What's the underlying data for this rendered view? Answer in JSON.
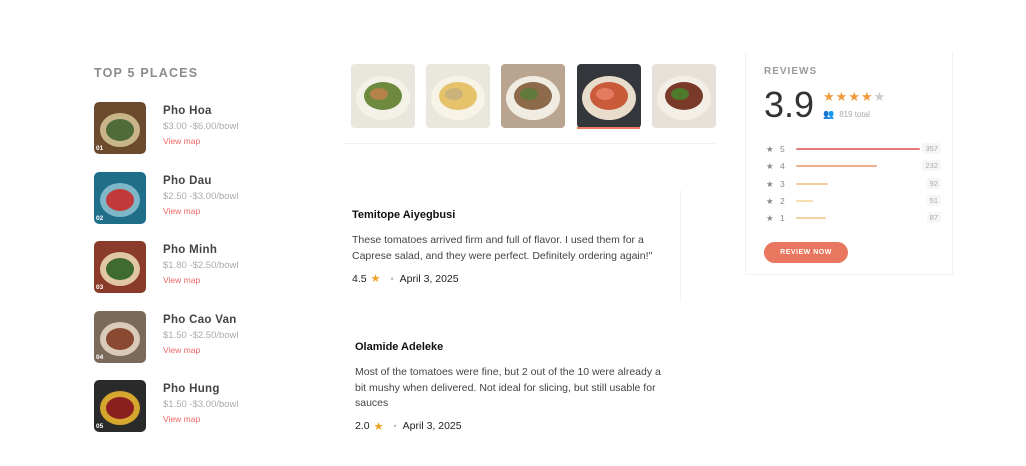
{
  "top_places": {
    "title": "TOP 5 PLACES",
    "items": [
      {
        "name": "Pho Hoa",
        "price": "$3.00 -$6.00/bowl",
        "link": "View map",
        "rank": "01"
      },
      {
        "name": "Pho Dau",
        "price": "$2.50 -$3.00/bowl",
        "link": "View map",
        "rank": "02"
      },
      {
        "name": "Pho Minh",
        "price": "$1.80 -$2.50/bowl",
        "link": "View map",
        "rank": "03"
      },
      {
        "name": "Pho Cao Van",
        "price": "$1.50 -$2.50/bowl",
        "link": "View map",
        "rank": "04"
      },
      {
        "name": "Pho Hung",
        "price": "$1.50 -$3.00/bowl",
        "link": "View map",
        "rank": "05"
      }
    ]
  },
  "gallery": {
    "images": [
      "pho-bowl-photo",
      "pho-bowl-photo",
      "pho-bowl-photo",
      "pho-bowl-photo",
      "pho-bowl-photo"
    ],
    "active_index": 3
  },
  "reviews": [
    {
      "author": "Temitope Aiyegbusi",
      "text": "These tomatoes arrived firm and full of flavor. I used them for a Caprese salad, and they were perfect. Definitely ordering again!\"",
      "rating": "4.5",
      "date": "April 3, 2025"
    },
    {
      "author": "Olamide Adeleke",
      "text": "Most of the tomatoes were fine, but 2 out of the 10 were already a bit mushy when delivered. Not ideal for slicing, but still usable for sauces",
      "rating": "2.0",
      "date": "April 3, 2025"
    }
  ],
  "summary": {
    "title": "REVIEWS",
    "score": "3.9",
    "stars_filled": 4,
    "stars_total": 5,
    "total": "819 total",
    "distribution": [
      {
        "stars": "5",
        "count": "357",
        "fraction": 1.0
      },
      {
        "stars": "4",
        "count": "232",
        "fraction": 0.65
      },
      {
        "stars": "3",
        "count": "92",
        "fraction": 0.26
      },
      {
        "stars": "2",
        "count": "51",
        "fraction": 0.14
      },
      {
        "stars": "1",
        "count": "87",
        "fraction": 0.24
      }
    ],
    "button_label": "REVIEW NOW"
  },
  "colors": {
    "accent": "#e9765e",
    "star": "#f0a020",
    "link": "#e66666",
    "bar_colors": [
      "#e77a7a",
      "#efae8e",
      "#f3cca0",
      "#f6deb0",
      "#f3d0a6"
    ]
  }
}
